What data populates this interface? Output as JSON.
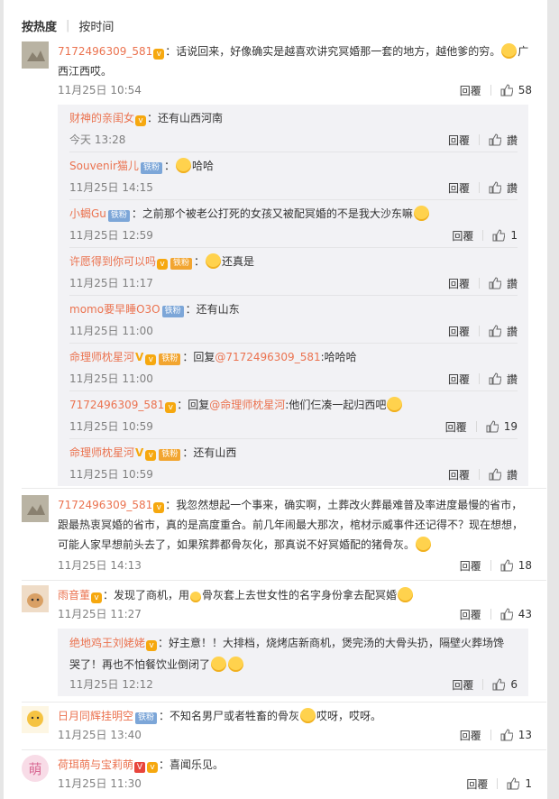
{
  "sort": {
    "hot": "按热度",
    "time": "按时间"
  },
  "labels": {
    "reply": "回覆",
    "like_zan": "讚"
  },
  "comments": [
    {
      "user": "7172496309_581",
      "text": "：话说回来，好像确实是越喜欢讲究冥婚那一套的地方，越他爹的穷。",
      "text_tail": "广",
      "text2": "西江西哎。",
      "time": "11月25日 10:54",
      "likes": "58",
      "replies": [
        {
          "user": "财神的亲闺女",
          "text": "：还有山西河南",
          "time": "今天 13:28",
          "likes": ""
        },
        {
          "user": "Souvenir猫儿",
          "fan": "铁粉",
          "text": "哈哈",
          "time": "11月25日 14:15",
          "likes": ""
        },
        {
          "user": "小蝎Gu",
          "fan": "铁粉",
          "text": "：之前那个被老公打死的女孩又被配冥婚的不是我大沙东嘛",
          "time": "11月25日 12:59",
          "likes": "1"
        },
        {
          "user": "许愿得到你可以吗",
          "fan": "铁粉",
          "text": "还真是",
          "time": "11月25日 11:17",
          "likes": ""
        },
        {
          "user": "momo要早睡O3O",
          "fan": "铁粉",
          "text": "：还有山东",
          "time": "11月25日 11:00",
          "likes": ""
        },
        {
          "user": "命理师枕星河",
          "fan": "铁粉",
          "text_pre": "：回复",
          "mention": "@7172496309_581",
          "text": ":哈哈哈",
          "time": "11月25日 11:00",
          "likes": ""
        },
        {
          "user": "7172496309_581",
          "text_pre": "：回复",
          "mention": "@命理师枕星河",
          "text": ":他们仨凑一起归西吧",
          "time": "11月25日 10:59",
          "likes": "19"
        },
        {
          "user": "命理师枕星河",
          "fan": "铁粉",
          "text": "：还有山西",
          "time": "11月25日 10:59",
          "likes": ""
        }
      ]
    },
    {
      "user": "7172496309_581",
      "line1": "：我忽然想起一个事来，确实啊，土葬改火葬最难普及率进度最慢的省市，",
      "line2": "跟最热衷冥婚的省市，真的是高度重合。前几年闹最大那次，棺材示威事件还记得不？现在想想，",
      "line3": "可能人家早想前头去了，如果殡葬都骨灰化，那真说不好冥婚配的猪骨灰。",
      "time": "11月25日 14:13",
      "likes": "18"
    },
    {
      "user": "雨音董",
      "text": "：发现了商机，用",
      "text_b": "骨灰套上去世女性的名字身份拿去配冥婚",
      "time": "11月25日 11:27",
      "likes": "43",
      "reply": {
        "user": "绝地鸡王刘姥姥",
        "line1": "：好主意！！大排档，烧烤店新商机，煲完汤的大骨头扔，隔壁火葬场馋",
        "line2": "哭了！再也不怕餐饮业倒闭了",
        "time": "11月25日 12:12",
        "likes": "6"
      }
    },
    {
      "user": "日月同辉挂明空",
      "fan": "铁粉",
      "text": "：不知名男尸或者牲畜的骨灰",
      "text_b": "哎呀，哎呀。",
      "time": "11月25日 13:40",
      "likes": "13"
    },
    {
      "user": "荷珥萌与宝莉萌",
      "text": "：喜闻乐见。",
      "time": "11月25日 11:30",
      "likes": "1"
    }
  ],
  "colors": {
    "username": "#eb7350",
    "reply_bg": "#f2f2f5",
    "fan_badge": "#7ca6d8"
  },
  "icons": {
    "like": "thumbs-up-icon",
    "emoji": "emoji-icon",
    "vip": "vip-badge-icon"
  }
}
